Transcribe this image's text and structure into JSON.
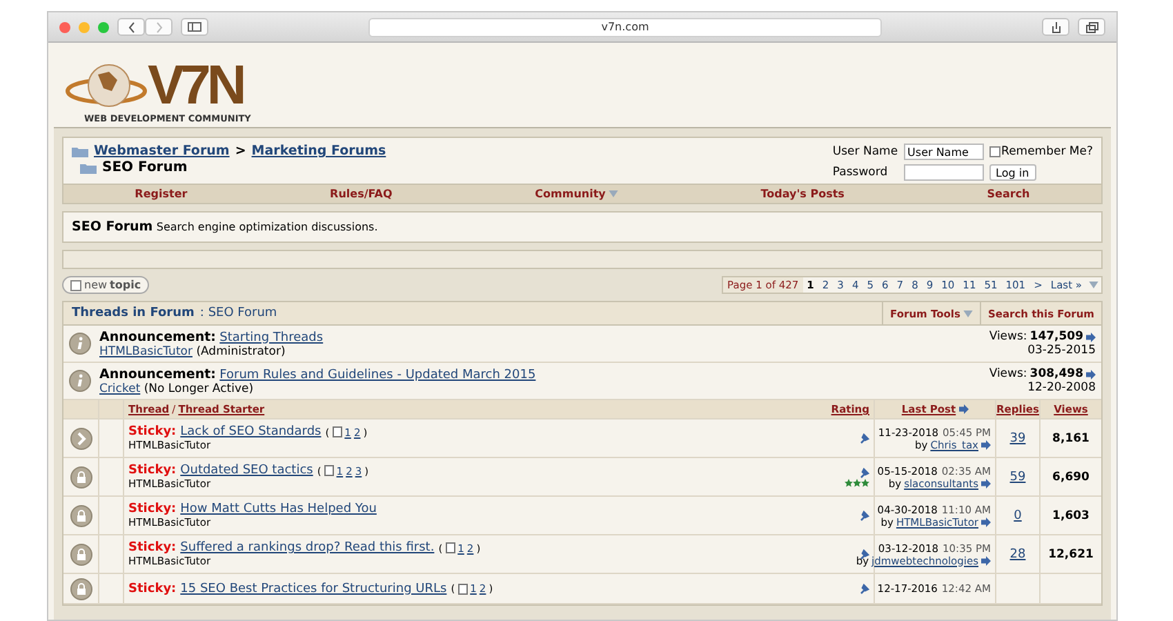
{
  "browser": {
    "url": "v7n.com"
  },
  "logo": {
    "mark": "V7N",
    "tagline": "WEB DEVELOPMENT COMMUNITY"
  },
  "breadcrumb": {
    "links": [
      "Webmaster Forum",
      "Marketing Forums"
    ],
    "separator": ">",
    "current": "SEO Forum"
  },
  "login": {
    "username_label": "User Name",
    "username_value": "User Name",
    "remember_label": "Remember Me?",
    "remember_checked": false,
    "password_label": "Password",
    "button": "Log in"
  },
  "navbar": [
    {
      "label": "Register",
      "dropdown": false
    },
    {
      "label": "Rules/FAQ",
      "dropdown": false
    },
    {
      "label": "Community",
      "dropdown": true
    },
    {
      "label": "Today's Posts",
      "dropdown": false
    },
    {
      "label": "Search",
      "dropdown": false
    }
  ],
  "forum_info": {
    "title": "SEO Forum",
    "description": "Search engine optimization discussions."
  },
  "new_topic": {
    "light": "new",
    "bold": "topic"
  },
  "pagination": {
    "label": "Page 1 of 427",
    "pages": [
      {
        "label": "1",
        "selected": true
      },
      {
        "label": "2",
        "selected": false
      },
      {
        "label": "3",
        "selected": false
      },
      {
        "label": "4",
        "selected": false
      },
      {
        "label": "5",
        "selected": false
      },
      {
        "label": "6",
        "selected": false
      },
      {
        "label": "7",
        "selected": false
      },
      {
        "label": "8",
        "selected": false
      },
      {
        "label": "9",
        "selected": false
      },
      {
        "label": "10",
        "selected": false
      },
      {
        "label": "11",
        "selected": false
      },
      {
        "label": "51",
        "selected": false
      },
      {
        "label": "101",
        "selected": false
      },
      {
        "label": ">",
        "selected": false
      },
      {
        "label": "Last »",
        "selected": false
      }
    ]
  },
  "threads_header": {
    "title": "Threads in Forum",
    "subtitle": ": SEO Forum",
    "tools": "Forum Tools",
    "search": "Search this Forum"
  },
  "announcements": [
    {
      "prefix": "Announcement:",
      "title": "Starting Threads",
      "starter": "HTMLBasicTutor",
      "note": "(Administrator)",
      "views_label": "Views:",
      "views": "147,509",
      "date": "03-25-2015"
    },
    {
      "prefix": "Announcement:",
      "title": "Forum Rules and Guidelines - Updated March 2015",
      "starter": "Cricket",
      "note": "(No Longer Active)",
      "views_label": "Views:",
      "views": "308,498",
      "date": "12-20-2008"
    }
  ],
  "columns": {
    "thread": "Thread",
    "separator": "/",
    "starter": "Thread Starter",
    "rating": "Rating",
    "last_post": "Last Post",
    "replies": "Replies",
    "views": "Views"
  },
  "threads": [
    {
      "kind": "hot",
      "prefix": "Sticky:",
      "title": "Lack of SEO Standards",
      "pages": {
        "open": "(",
        "numbers": [
          "1",
          "2"
        ],
        "close": ")"
      },
      "starter": "HTMLBasicTutor",
      "date": "11-23-2018",
      "time": "05:45 PM",
      "by": "by",
      "last_user": "Chris_tax",
      "replies": "39",
      "views": "8,161"
    },
    {
      "kind": "locked",
      "prefix": "Sticky:",
      "title": "Outdated SEO tactics",
      "pages": {
        "open": "(",
        "numbers": [
          "1",
          "2",
          "3"
        ],
        "close": ")"
      },
      "starter": "HTMLBasicTutor",
      "stars": 3,
      "date": "05-15-2018",
      "time": "02:35 AM",
      "by": "by",
      "last_user": "slaconsultants",
      "replies": "59",
      "views": "6,690"
    },
    {
      "kind": "locked",
      "prefix": "Sticky:",
      "title": "How Matt Cutts Has Helped You",
      "starter": "HTMLBasicTutor",
      "date": "04-30-2018",
      "time": "11:10 AM",
      "by": "by",
      "last_user": "HTMLBasicTutor",
      "replies": "0",
      "views": "1,603"
    },
    {
      "kind": "locked",
      "prefix": "Sticky:",
      "title": "Suffered a rankings drop? Read this first.",
      "pages": {
        "open": "(",
        "numbers": [
          "1",
          "2"
        ],
        "close": ")"
      },
      "starter": "HTMLBasicTutor",
      "date": "03-12-2018",
      "time": "10:35 PM",
      "by": "by",
      "last_user": "jdmwebtechnologies",
      "replies": "28",
      "views": "12,621"
    },
    {
      "kind": "locked",
      "prefix": "Sticky:",
      "title": "15 SEO Best Practices for Structuring URLs",
      "pages": {
        "open": "(",
        "numbers": [
          "1",
          "2"
        ],
        "close": ")"
      },
      "date": "12-17-2016",
      "time": "12:42 AM"
    }
  ]
}
